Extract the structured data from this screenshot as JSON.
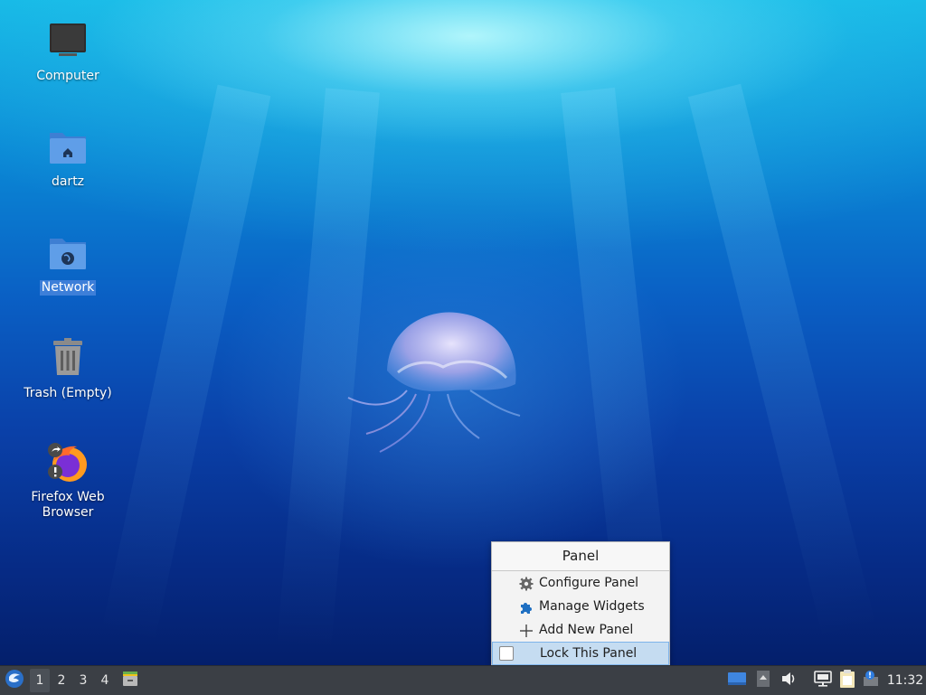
{
  "desktop": {
    "icons": [
      {
        "label": "Computer"
      },
      {
        "label": "dartz"
      },
      {
        "label": "Network"
      },
      {
        "label": "Trash (Empty)"
      },
      {
        "label": "Firefox Web Browser"
      }
    ]
  },
  "context_menu": {
    "title": "Panel",
    "items": [
      {
        "label": "Configure Panel",
        "icon": "gear-icon"
      },
      {
        "label": "Manage Widgets",
        "icon": "puzzle-icon"
      },
      {
        "label": "Add New Panel",
        "icon": "plus-icon"
      },
      {
        "label": "Lock This Panel",
        "icon": "checkbox",
        "checked": false
      }
    ]
  },
  "taskbar": {
    "workspaces": [
      "1",
      "2",
      "3",
      "4"
    ],
    "active_workspace": "1",
    "clock": "11:32"
  },
  "colors": {
    "menu_highlight": "#c5dcf1",
    "taskbar_bg": "#3b3f45",
    "selection": "#3d7fd9"
  }
}
